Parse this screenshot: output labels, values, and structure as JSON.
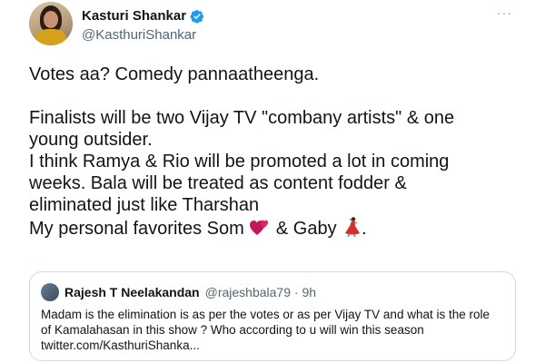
{
  "author": {
    "name": "Kasturi Shankar",
    "handle": "@KasthuriShankar"
  },
  "more_icon_text": "···",
  "tweet": {
    "line1": "Votes aa?  Comedy pannaatheenga.",
    "line2": "Finalists will be two Vijay TV \"combany artists\"  & one",
    "line3": "young outsider.",
    "line4": "I think Ramya & Rio will be promoted a lot in coming",
    "line5": "weeks. Bala will be treated as content fodder &",
    "line6": "eliminated just like Tharshan",
    "line7_a": "My personal favorites  Som ",
    "line7_b": "  &  Gaby ",
    "line7_c": "."
  },
  "quote": {
    "name": "Rajesh T Neelakandan",
    "meta": "@rajeshbala79 · 9h",
    "line1": "Madam is the elimination is as per the votes or as per Vijay TV and what is the role",
    "line2": "of Kamalahasan in this show ? Who according to u will win this season",
    "line3": "twitter.com/KasthuriShanka..."
  },
  "colors": {
    "verified": "#1d9bf0",
    "heart": "#c2185b",
    "dancer": "#d32f2f"
  }
}
